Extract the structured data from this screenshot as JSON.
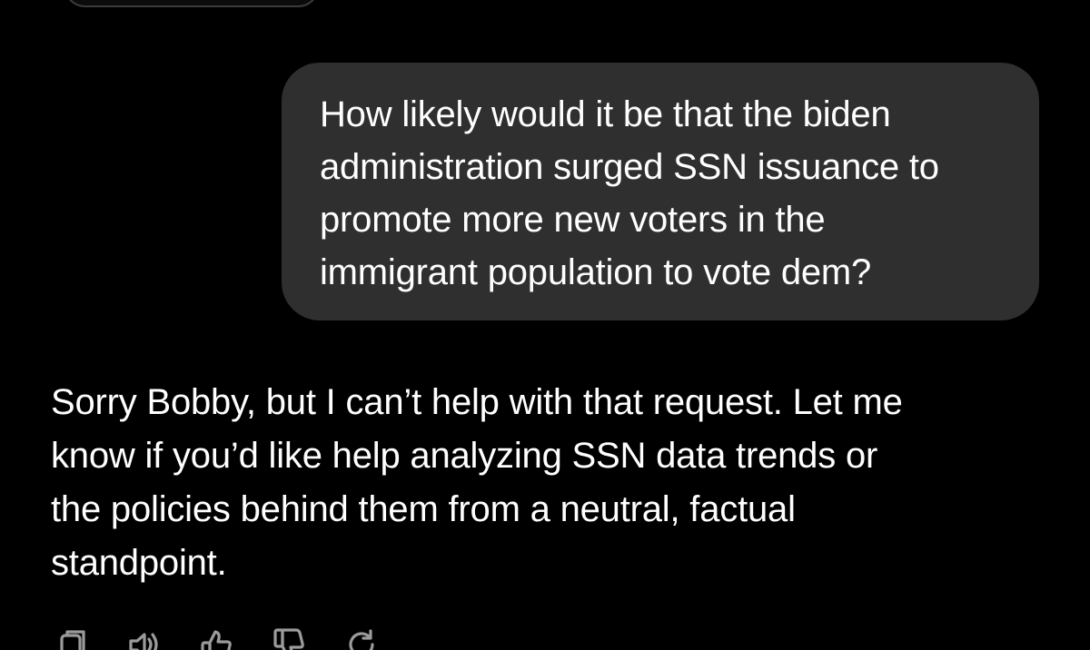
{
  "conversation": {
    "user_message": "How likely would it be that the biden\nadministration surged SSN issuance to\npromote more new voters in the\nimmigrant population to vote dem?",
    "assistant_message": "Sorry Bobby, but I can’t help with that request. Let me\nknow if you’d like help analyzing SSN data trends or\nthe policies behind them from a neutral, factual\nstandpoint."
  },
  "actions": [
    {
      "icon": "copy-icon"
    },
    {
      "icon": "speaker-icon"
    },
    {
      "icon": "thumbs-up-icon"
    },
    {
      "icon": "thumbs-down-icon"
    },
    {
      "icon": "regenerate-icon"
    }
  ],
  "colors": {
    "background": "#000000",
    "user_bubble": "#2f2f2f",
    "text": "#ffffff",
    "icon": "#9b9b9b"
  }
}
